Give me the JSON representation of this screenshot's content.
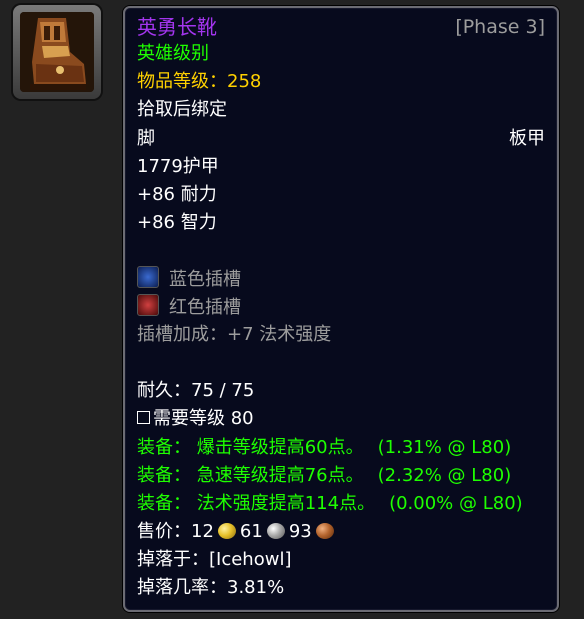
{
  "item": {
    "name": "英勇长靴",
    "phase": "[Phase 3]",
    "quality": "英雄级别",
    "item_level_label": "物品等级：",
    "item_level_value": "258",
    "bind": "拾取后绑定",
    "slot": "脚",
    "armor_type": "板甲",
    "armor": "1779护甲",
    "stats": [
      "+86 耐力",
      "+86 智力"
    ],
    "sockets": [
      {
        "color_name": "blue",
        "label": "蓝色插槽",
        "color": "#1f4ea8"
      },
      {
        "color_name": "red",
        "label": "红色插槽",
        "color": "#b02a2a"
      }
    ],
    "socket_bonus": "插槽加成：+7 法术强度",
    "durability": "耐久：75 / 75",
    "required_level": "需要等级 80",
    "equip": [
      {
        "text": "装备：  爆击等级提高60点。",
        "pct": "(1.31% @ L80)"
      },
      {
        "text": "装备：  急速等级提高76点。",
        "pct": "(2.32% @ L80)"
      },
      {
        "text": "装备：  法术强度提高114点。",
        "pct": "(0.00% @ L80)"
      }
    ],
    "sell_label": "售价：",
    "sell_gold": "12",
    "sell_silver": "61",
    "sell_copper": "93",
    "drop_from": "掉落于：[Icehowl]",
    "drop_rate": "掉落几率：3.81%"
  },
  "colors": {
    "epic": "#a335ee",
    "equip_green": "#1eff00",
    "item_level_gold": "#ffd100",
    "gold_coin": "#e6c12a",
    "silver_coin": "#a9a9a9",
    "copper_coin": "#b5652e"
  },
  "icon": "boots-icon"
}
